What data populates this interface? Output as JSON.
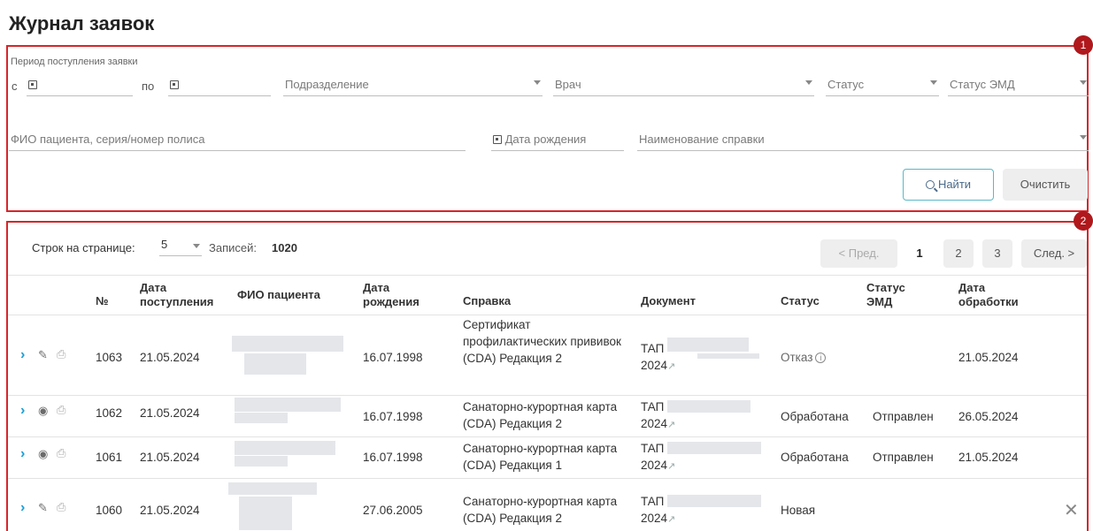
{
  "page": {
    "title": "Журнал заявок"
  },
  "badges": {
    "one": "1",
    "two": "2"
  },
  "filters": {
    "period_label": "Период поступления заявки",
    "from_prefix": "с",
    "to_prefix": "по",
    "department": "Подразделение",
    "doctor": "Врач",
    "status": "Статус",
    "emd_status": "Статус ЭМД",
    "patient": "ФИО пациента, серия/номер полиса",
    "birth_date": "Дата рождения",
    "certificate_name": "Наименование справки",
    "find_label": "Найти",
    "clear_label": "Очистить"
  },
  "pager": {
    "rows_label": "Строк на странице:",
    "rows_value": "5",
    "records_label": "Записей:",
    "records_value": "1020",
    "prev_label": "< Пред.",
    "next_label": "След. >",
    "pages": [
      "1",
      "2",
      "3"
    ]
  },
  "table": {
    "headers": {
      "num": "№",
      "received": "Дата поступления",
      "patient": "ФИО пациента",
      "birth": "Дата рождения",
      "certificate": "Справка",
      "document": "Документ",
      "status": "Статус",
      "emd": "Статус ЭМД",
      "processed": "Дата обработки"
    },
    "rows": [
      {
        "num": "1063",
        "received": "21.05.2024",
        "birth": "16.07.1998",
        "certificate": "Сертификат профилактических прививок (CDA) Редакция 2",
        "doc_prefix": "ТАП",
        "doc_year": "2024",
        "status": "Отказ",
        "emd": "",
        "processed": "21.05.2024"
      },
      {
        "num": "1062",
        "received": "21.05.2024",
        "birth": "16.07.1998",
        "certificate": "Санаторно-курортная карта (CDA) Редакция 2",
        "doc_prefix": "ТАП",
        "doc_year": "2024",
        "status": "Обработана",
        "emd": "Отправлен",
        "processed": "26.05.2024"
      },
      {
        "num": "1061",
        "received": "21.05.2024",
        "birth": "16.07.1998",
        "certificate": "Санаторно-курортная карта (CDA) Редакция 1",
        "doc_prefix": "ТАП",
        "doc_year": "2024",
        "status": "Обработана",
        "emd": "Отправлен",
        "processed": "21.05.2024"
      },
      {
        "num": "1060",
        "received": "21.05.2024",
        "birth": "27.06.2005",
        "certificate": "Санаторно-курортная карта (CDA) Редакция 2",
        "doc_prefix": "ТАП",
        "doc_year": "2024",
        "status": "Новая",
        "emd": "",
        "processed": ""
      }
    ]
  }
}
